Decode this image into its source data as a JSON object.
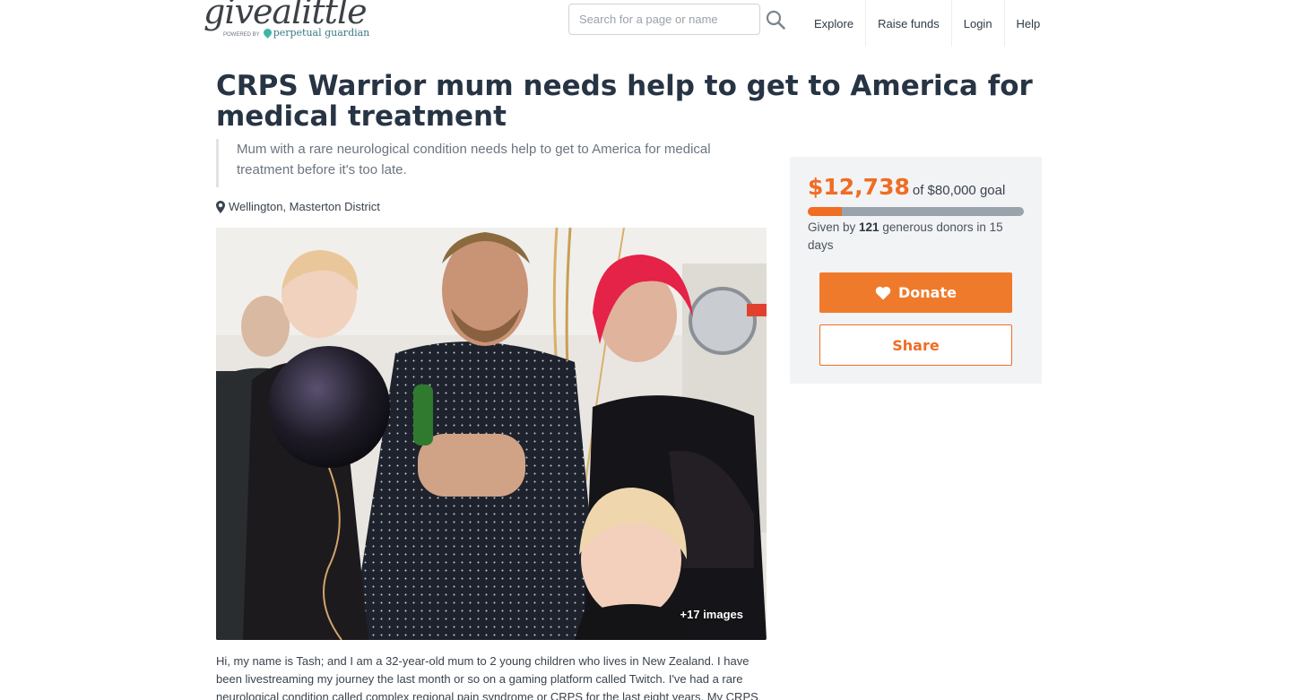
{
  "header": {
    "logo_text": "givealittle",
    "logo_powered_by": "POWERED BY",
    "logo_partner": "perpetual guardian",
    "search_placeholder": "Search for a page or name",
    "nav": [
      "Explore",
      "Raise funds",
      "Login",
      "Help"
    ]
  },
  "page": {
    "title": "CRPS Warrior mum needs help to get to America for medical treatment",
    "blurb": "Mum with a rare neurological condition needs help to get to America for medical treatment before it's too late.",
    "location": "Wellington, Masterton District",
    "images_badge": "+17 images",
    "story": "Hi, my name is Tash; and I am a 32-year-old mum to 2 young children who lives in New Zealand. I have been livestreaming my journey the last month or so on a gaming platform called Twitch. I've had a rare neurological condition called complex regional pain syndrome or CRPS for the last eight years. My CRPS"
  },
  "fundraising": {
    "raised": "$12,738",
    "goal_text": "of $80,000 goal",
    "progress_fraction": 0.159,
    "donors_prefix": "Given by ",
    "donors_count": "121",
    "donors_suffix": " generous donors in 15 days",
    "donate_label": "Donate",
    "share_label": "Share"
  },
  "colors": {
    "accent": "#ef6d24",
    "title": "#273444",
    "panel": "#f2f3f5"
  },
  "icons": {
    "search": "search-icon",
    "location": "map-marker-icon",
    "donate": "heart-icon"
  }
}
